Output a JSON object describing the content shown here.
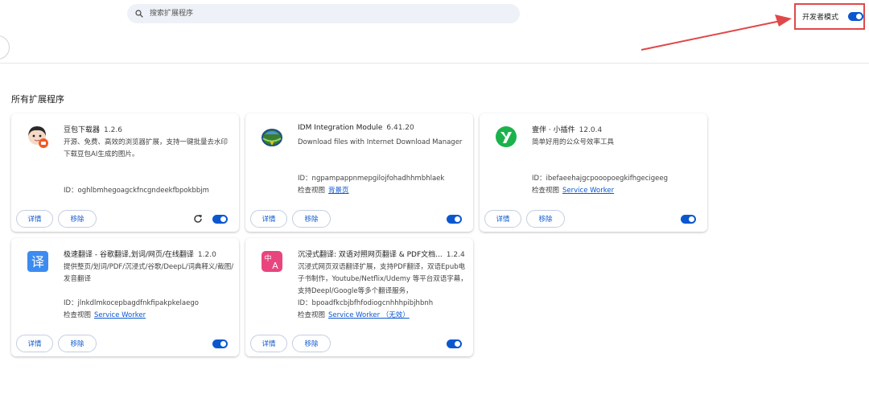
{
  "search": {
    "placeholder": "搜索扩展程序"
  },
  "dev_mode": {
    "label": "开发者模式",
    "enabled": true
  },
  "section_title": "所有扩展程序",
  "buttons": {
    "details": "详情",
    "remove": "移除"
  },
  "colors": {
    "accent": "#0b57d0",
    "highlight_red": "#e0484a"
  },
  "extensions": [
    {
      "name": "豆包下载器",
      "version": "1.2.6",
      "description": "开源、免费、高效的浏览器扩展，支持一键批量去水印下载豆包AI生成的图片。",
      "id": "ID：oghlbmhegoagckfncgndeekfbpokbbjm",
      "inspect_label": "",
      "inspect_link": "",
      "enabled": true,
      "has_reload": true,
      "icon": "doubao-avatar-icon"
    },
    {
      "name": "IDM Integration Module",
      "version": "6.41.20",
      "description": "Download files with Internet Download Manager",
      "id": "ID：ngpampappnmepgilojfohadhhmbhlaek",
      "inspect_label": "检查视图",
      "inspect_link": "背景页",
      "enabled": true,
      "has_reload": false,
      "icon": "idm-globe-icon"
    },
    {
      "name": "壹伴 · 小插件",
      "version": "12.0.4",
      "description": "简单好用的公众号效率工具",
      "id": "ID：ibefaeehajgcpooopoegkifhgecigeeg",
      "inspect_label": "检查视图",
      "inspect_link": "Service Worker",
      "enabled": true,
      "has_reload": false,
      "icon": "yiban-y-icon"
    },
    {
      "name": "极速翻译 - 谷歌翻译,划词/网页/在线翻译",
      "version": "1.2.0",
      "description": "提供整页/划词/PDF/沉浸式/谷歌/DeepL/词典释义/截图/发音翻译",
      "id": "ID：jlnkdlmkocepbagdfnkfipakpkelaego",
      "inspect_label": "检查视图",
      "inspect_link": "Service Worker",
      "enabled": true,
      "has_reload": false,
      "icon": "translate-yi-icon"
    },
    {
      "name": "沉浸式翻译: 双语对照网页翻译 & PDF文档...",
      "version": "1.2.4",
      "description": "沉浸式网页双语翻译扩展，支持PDF翻译，双语Epub电子书制作，Youtube/Netflix/Udemy 等平台双语字幕，支持Deepl/Google等多个翻译服务，",
      "id": "ID：bpoadfkcbjbfhfodiogcnhhhpibjhbnh",
      "inspect_label": "检查视图",
      "inspect_link": "Service Worker （无效）",
      "enabled": true,
      "has_reload": false,
      "icon": "immersive-translate-icon"
    }
  ]
}
